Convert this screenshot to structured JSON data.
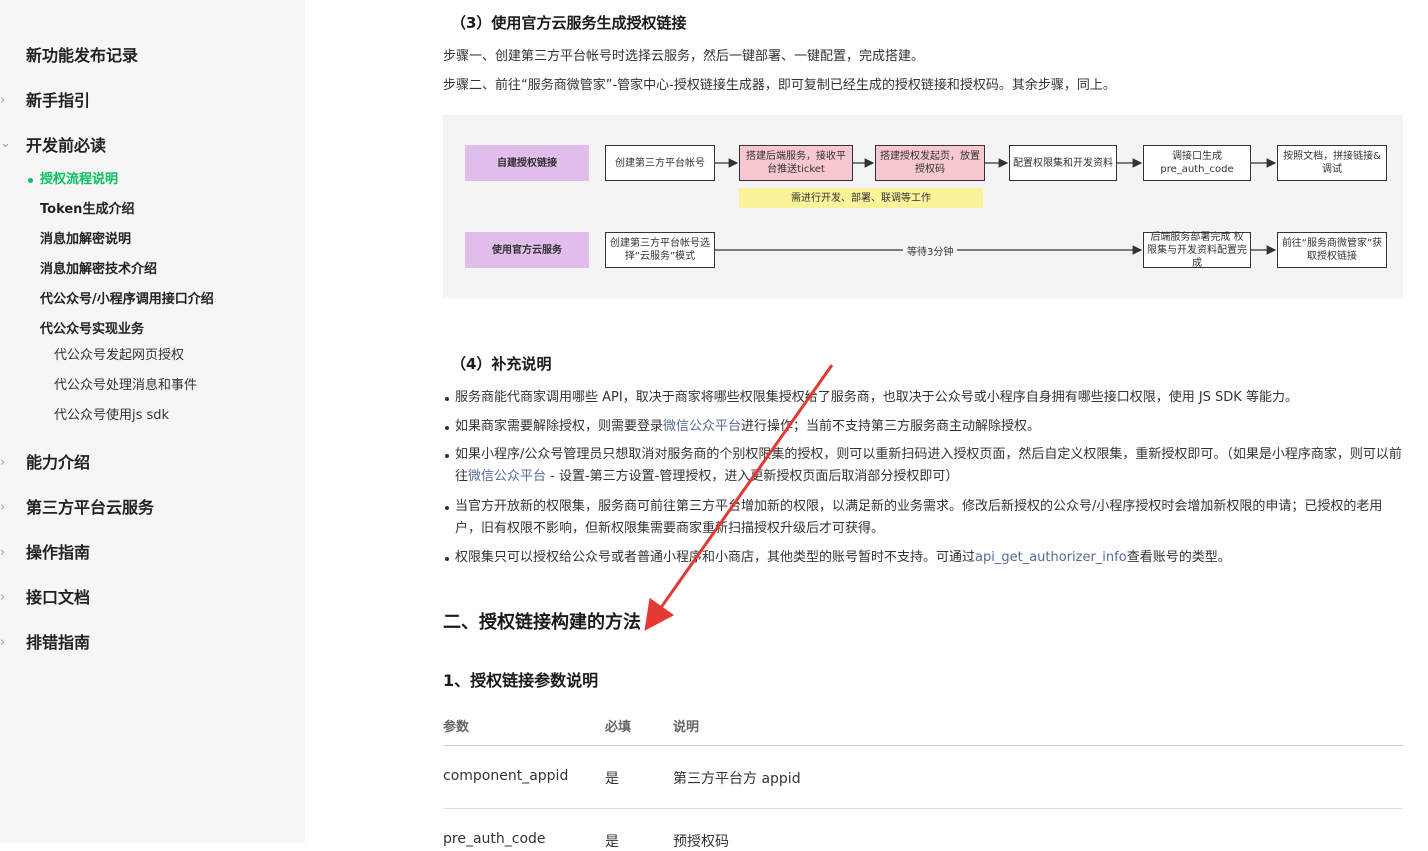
{
  "sidebar": {
    "items": [
      {
        "label": "新功能发布记录",
        "chevron": ""
      },
      {
        "label": "新手指引",
        "chevron": "›"
      },
      {
        "label": "开发前必读",
        "chevron": "⌄"
      },
      {
        "label": "能力介绍",
        "chevron": "›"
      },
      {
        "label": "第三方平台云服务",
        "chevron": "›"
      },
      {
        "label": "操作指南",
        "chevron": "›"
      },
      {
        "label": "接口文档",
        "chevron": "›"
      },
      {
        "label": "排错指南",
        "chevron": "›"
      }
    ],
    "sub_items": [
      "授权流程说明",
      "Token生成介绍",
      "消息加解密说明",
      "消息加解密技术介绍",
      "代公众号/小程序调用接口介绍",
      "代公众号实现业务"
    ],
    "sub_sub_items": [
      "代公众号发起网页授权",
      "代公众号处理消息和事件",
      "代公众号使用js sdk"
    ],
    "active_color": "#07c160"
  },
  "content": {
    "section3_title": "（3）使用官方云服务生成授权链接",
    "step1": "步骤一、创建第三方平台帐号时选择云服务，然后一键部署、一键配置，完成搭建。",
    "step2": "步骤二、前往“服务商微管家”-管家中心-授权链接生成器，即可复制已经生成的授权链接和授权码。其余步骤，同上。",
    "flow": {
      "row1_label": "自建授权链接",
      "row1_boxes": [
        "创建第三方平台帐号",
        "搭建后端服务，接收平台推送ticket",
        "搭建授权发起页，放置授权码",
        "配置权限集和开发资料",
        "调接口生成 pre_auth_code",
        "按照文档，拼接链接&调试"
      ],
      "note": "需进行开发、部署、联调等工作",
      "row2_label": "使用官方云服务",
      "row2_boxes": [
        "创建第三方平台帐号选择“云服务”模式",
        "后端服务部署完成 权限集与开发资料配置完成",
        "前往“服务商微管家”获取授权链接"
      ],
      "wait_label": "等待3分钟"
    },
    "section4_title": "（4）补充说明",
    "bullets": [
      {
        "text": "服务商能代商家调用哪些 API，取决于商家将哪些权限集授权给了服务商，也取决于公众号或小程序自身拥有哪些接口权限，使用 JS SDK 等能力。"
      },
      {
        "pre": "如果商家需要解除授权，则需要登录",
        "link": "微信公众平台",
        "post": "进行操作；当前不支持第三方服务商主动解除授权。"
      },
      {
        "pre": "如果小程序/公众号管理员只想取消对服务商的个别权限集的授权，则可以重新扫码进入授权页面，然后自定义权限集，重新授权即可。（如果是小程序商家，则可以前往",
        "link": "微信公众平台",
        "post": " - 设置-第三方设置-管理授权，进入更新授权页面后取消部分授权即可）"
      },
      {
        "text": "当官方开放新的权限集，服务商可前往第三方平台增加新的权限，以满足新的业务需求。修改后新授权的公众号/小程序授权时会增加新权限的申请；已授权的老用户，旧有权限不影响，但新权限集需要商家重新扫描授权升级后才可获得。"
      },
      {
        "pre": "权限集只可以授权给公众号或者普通小程序和小商店，其他类型的账号暂时不支持。可通过",
        "link": "api_get_authorizer_info",
        "post": "查看账号的类型。"
      }
    ],
    "section2_title": "二、授权链接构建的方法",
    "sub1_title": "1、授权链接参数说明",
    "table": {
      "headers": [
        "参数",
        "必填",
        "说明"
      ],
      "rows": [
        [
          "component_appid",
          "是",
          "第三方平台方 appid"
        ],
        [
          "pre_auth_code",
          "是",
          "预授权码"
        ]
      ]
    },
    "link_color": "#576b95",
    "arrow_color": "#e53935"
  }
}
